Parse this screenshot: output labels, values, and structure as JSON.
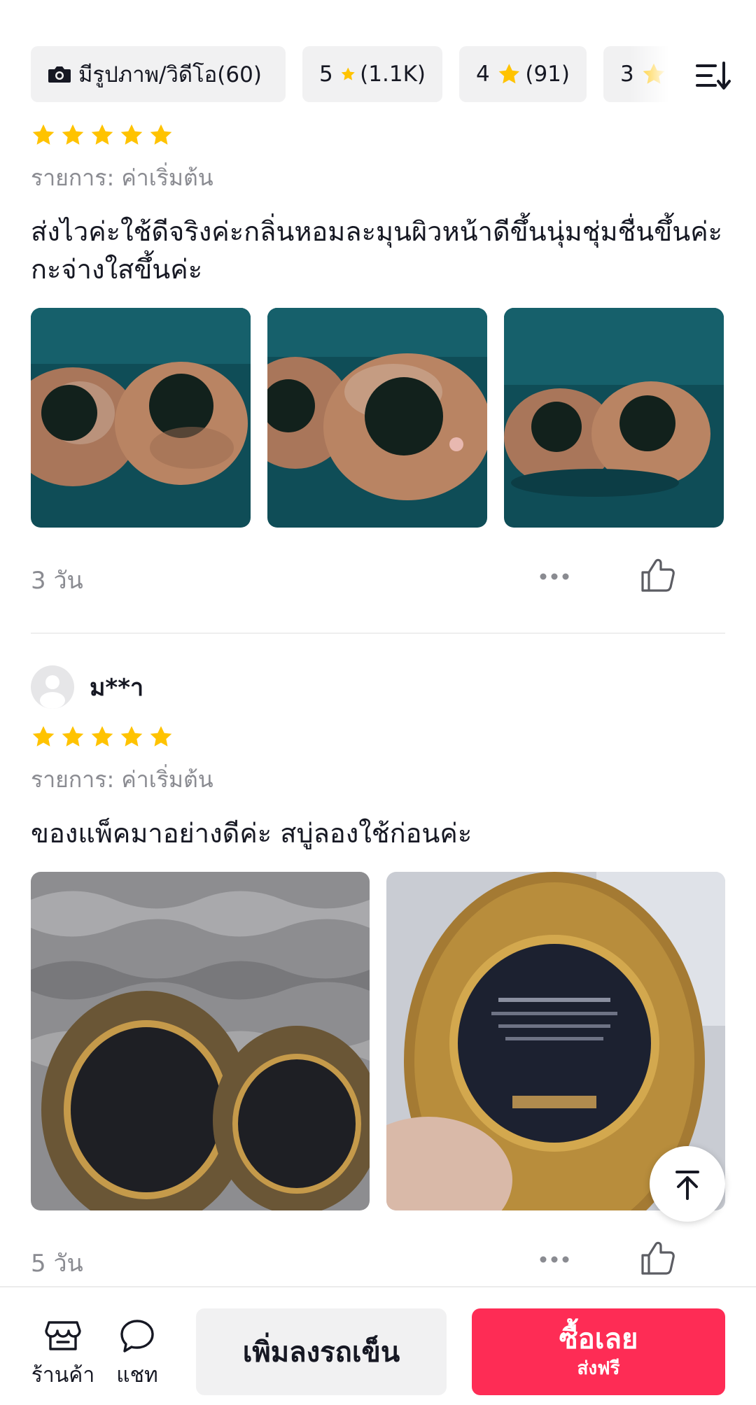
{
  "filters": [
    {
      "icon": "camera-icon",
      "label": "มีรูปภาพ/วิดีโอ(60)"
    },
    {
      "num": "5",
      "icon": "star-icon",
      "count": "(1.1K)"
    },
    {
      "num": "4",
      "icon": "star-icon",
      "count": "(91)"
    },
    {
      "num": "3",
      "icon": "star-icon",
      "count": ""
    }
  ],
  "sort_icon": "sort-icon",
  "reviews": [
    {
      "username": "",
      "rating": 5,
      "variant": "รายการ: ค่าเริ่มต้น",
      "text": "ส่งไวค่ะใช้ดีจริงค่ะกลิ่นหอมละมุนผิวหน้าดีขึ้นนุ่มชุ่มชื่นขึ้นค่ะกะจ่างใสขึ้นค่ะ",
      "photo_count": 3,
      "date": "3 วัน"
    },
    {
      "username": "ม**า",
      "rating": 5,
      "variant": "รายการ: ค่าเริ่มต้น",
      "text": "ของแพ็คมาอย่างดีค่ะ  สบู่ลองใช้ก่อนค่ะ",
      "photo_count": 2,
      "date": "5 วัน"
    }
  ],
  "bottom_bar": {
    "shop_label": "ร้านค้า",
    "chat_label": "แชท",
    "add_to_cart": "เพิ่มลงรถเข็น",
    "buy_now": "ซื้อเลย",
    "free_shipping": "ส่งฟรี"
  },
  "colors": {
    "star": "#FFC300",
    "buy_button": "#FE2C55",
    "chip_bg": "#F1F1F2",
    "muted_text": "#8A8B91"
  }
}
